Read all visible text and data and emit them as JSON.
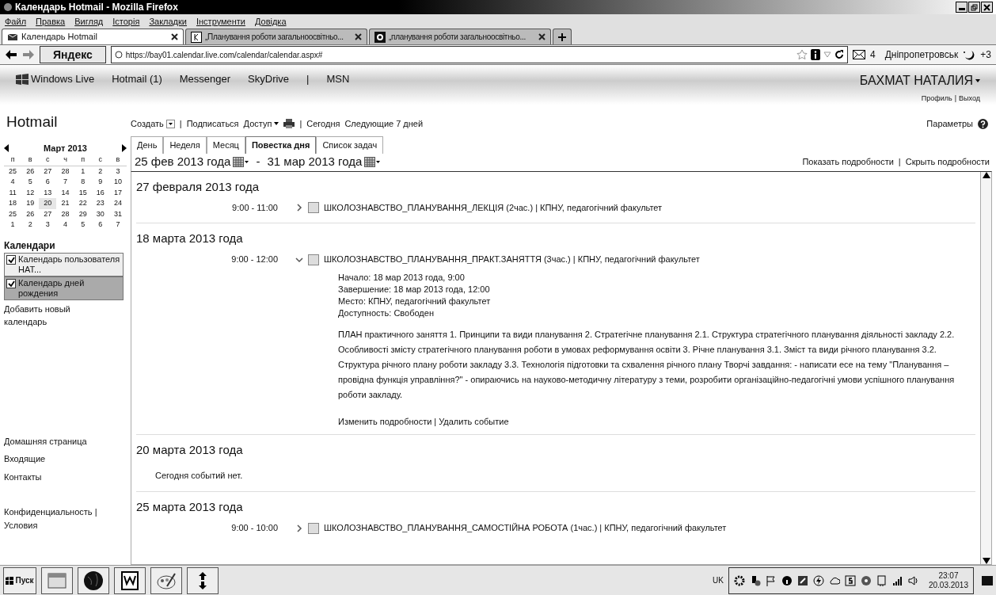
{
  "window": {
    "title": "Календарь Hotmail - Mozilla Firefox"
  },
  "menu": [
    "Файл",
    "Правка",
    "Вигляд",
    "Історія",
    "Закладки",
    "Інструменти",
    "Довідка"
  ],
  "browser_tabs": [
    {
      "label": "Календарь Hotmail",
      "selected": true,
      "kind": "mail"
    },
    {
      "label": "„Планування роботи загальноосвітньо...",
      "selected": false,
      "kind": "yandex"
    },
    {
      "label": "„планування роботи загальноосвітньо...",
      "selected": false,
      "kind": "google"
    }
  ],
  "nav_bar": {
    "yandex_button": "Яндекс",
    "url": "https://bay01.calendar.live.com/calendar/calendar.aspx#",
    "mail_count": "4",
    "city": "Дніпропетровськ",
    "temperature": "+3"
  },
  "site_header": {
    "brand": "Windows Live",
    "links": [
      "Hotmail (1)",
      "Messenger",
      "SkyDrive",
      "MSN"
    ],
    "links_separator": "|",
    "user_links_separator": "|",
    "user": "БАХМАТ НАТАЛИЯ",
    "user_links": [
      "Профиль",
      "Выход"
    ]
  },
  "sidebar": {
    "title": "Hotmail",
    "month": "Март 2013",
    "weekdays": [
      "п",
      "в",
      "с",
      "ч",
      "п",
      "с",
      "в"
    ],
    "weeks": [
      [
        {
          "day": "25",
          "today": false
        },
        {
          "day": "26",
          "today": false
        },
        {
          "day": "27",
          "today": false
        },
        {
          "day": "28",
          "today": false
        },
        {
          "day": "1",
          "today": false
        },
        {
          "day": "2",
          "today": false
        },
        {
          "day": "3",
          "today": false
        }
      ],
      [
        {
          "day": "4",
          "today": false
        },
        {
          "day": "5",
          "today": false
        },
        {
          "day": "6",
          "today": false
        },
        {
          "day": "7",
          "today": false
        },
        {
          "day": "8",
          "today": false
        },
        {
          "day": "9",
          "today": false
        },
        {
          "day": "10",
          "today": false
        }
      ],
      [
        {
          "day": "11",
          "today": false
        },
        {
          "day": "12",
          "today": false
        },
        {
          "day": "13",
          "today": false
        },
        {
          "day": "14",
          "today": false
        },
        {
          "day": "15",
          "today": false
        },
        {
          "day": "16",
          "today": false
        },
        {
          "day": "17",
          "today": false
        }
      ],
      [
        {
          "day": "18",
          "today": false
        },
        {
          "day": "19",
          "today": false
        },
        {
          "day": "20",
          "today": true
        },
        {
          "day": "21",
          "today": false
        },
        {
          "day": "22",
          "today": false
        },
        {
          "day": "23",
          "today": false
        },
        {
          "day": "24",
          "today": false
        }
      ],
      [
        {
          "day": "25",
          "today": false
        },
        {
          "day": "26",
          "today": false
        },
        {
          "day": "27",
          "today": false
        },
        {
          "day": "28",
          "today": false
        },
        {
          "day": "29",
          "today": false
        },
        {
          "day": "30",
          "today": false
        },
        {
          "day": "31",
          "today": false
        }
      ],
      [
        {
          "day": "1",
          "today": false
        },
        {
          "day": "2",
          "today": false
        },
        {
          "day": "3",
          "today": false
        },
        {
          "day": "4",
          "today": false
        },
        {
          "day": "5",
          "today": false
        },
        {
          "day": "6",
          "today": false
        },
        {
          "day": "7",
          "today": false
        }
      ]
    ],
    "calendars_heading": "Календари",
    "calendars": [
      {
        "label": "Календарь пользователя НАТ...",
        "checked": true,
        "selected": false
      },
      {
        "label": "Календарь дней рождения",
        "checked": true,
        "selected": true
      }
    ],
    "add_calendar": "Добавить новый календарь",
    "links": [
      "Домашняя страница",
      "Входящие",
      "Контакты"
    ],
    "footer_links": [
      "Конфиденциальность |",
      "Условия"
    ]
  },
  "toolbar": {
    "separator": "|",
    "create": "Создать",
    "subscribe": "Подписаться",
    "share": "Доступ",
    "today": "Сегодня",
    "next_days": "Следующие 7 дней",
    "options": "Параметры"
  },
  "view_tabs": [
    {
      "label": "День",
      "selected": false
    },
    {
      "label": "Неделя",
      "selected": false
    },
    {
      "label": "Месяц",
      "selected": false
    },
    {
      "label": "Повестка дня",
      "selected": true
    },
    {
      "label": "Список задач",
      "selected": false
    }
  ],
  "range": {
    "from": "25 фев 2013 года",
    "separator": "-",
    "links_separator": "|",
    "to": "31 мар 2013 года",
    "show_details": "Показать подробности",
    "hide_details": "Скрыть подробности"
  },
  "days": [
    {
      "date": "27 февраля 2013 года",
      "events": [
        {
          "time": "9:00 - 11:00",
          "expanded": false,
          "checked": false,
          "title": "ШКОЛОЗНАВСТВО_ПЛАНУВАННЯ_ЛЕКЦІЯ (2час.) | КПНУ, педагогічний факультет"
        }
      ]
    },
    {
      "date": "18 марта 2013 года",
      "events": [
        {
          "time": "9:00 - 12:00",
          "expanded": true,
          "checked": false,
          "title": "ШКОЛОЗНАВСТВО_ПЛАНУВАННЯ_ПРАКТ.ЗАНЯТТЯ (3час.) | КПНУ, педагогічний факультет",
          "details": [
            "Начало: 18 мар 2013 года, 9:00",
            "Завершение: 18 мар 2013 года, 12:00",
            "Место: КПНУ, педагогічний факультет",
            "Доступность: Свободен"
          ],
          "description": "ПЛАН практичного заняття 1. Принципи та види планування 2. Стратегічне планування 2.1. Структура стратегічного планування діяльності закладу 2.2. Особливості змісту стратегічного планування роботи в умовах реформування освіти 3. Річне планування 3.1. Зміст та види річного планування 3.2. Структура річного плану роботи закладу 3.3. Технологія підготовки та схвалення річного плану Творчі завдання: - написати есе на тему \"Планування – провідна функція управління?\" - опираючись на науково-методичну літературу з теми, розробити організаційно-педагогічні умови успішного планування роботи закладу.",
          "actions": [
            "Изменить подробности",
            "Удалить событие"
          ],
          "actions_separator": "|"
        }
      ]
    },
    {
      "date": "20 марта 2013 года",
      "empty_text": "Сегодня событий нет."
    },
    {
      "date": "25 марта 2013 года",
      "events": [
        {
          "time": "9:00 - 10:00",
          "expanded": false,
          "checked": false,
          "title": "ШКОЛОЗНАВСТВО_ПЛАНУВАННЯ_САМОСТІЙНА РОБОТА (1час.) | КПНУ, педагогічний факультет"
        }
      ]
    }
  ],
  "taskbar": {
    "start": "Пуск",
    "language": "UK",
    "time": "23:07",
    "date": "20.03.2013"
  }
}
